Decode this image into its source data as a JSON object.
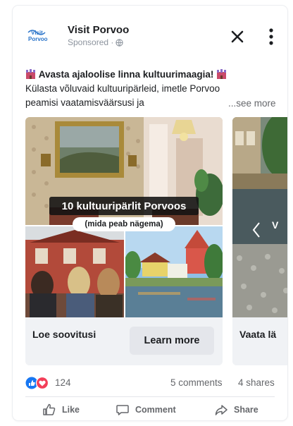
{
  "post": {
    "page_name": "Visit Porvoo",
    "sponsored": "Sponsored ·",
    "logo_line1": "Visit",
    "logo_line2": "Porvoo",
    "caption_line1": "Avasta ajaloolise linna kultuurimaagia!",
    "caption_line2": "Külasta võluvaid kultuuripärleid, imetle Porvoo",
    "caption_line3": "peamisi vaatamisväärsusi ja",
    "see_more": "...see more"
  },
  "carousel": {
    "cards": [
      {
        "overlay_title": "10 kultuuripärlit Porvoos",
        "overlay_sub": "(mida peab nägema)",
        "cta_title": "Loe soovitusi",
        "button": "Learn more"
      },
      {
        "cta_title": "Vaata lä"
      }
    ]
  },
  "stats": {
    "reactions": "124",
    "comments": "5 comments",
    "shares": "4 shares"
  },
  "actions": {
    "like": "Like",
    "comment": "Comment",
    "share": "Share"
  },
  "colors": {
    "like_blue": "#1877f2",
    "love_red": "#f33e58",
    "logo_blue": "#2a74c9"
  },
  "icons": [
    "globe-icon",
    "close-icon",
    "more-vertical-icon",
    "castle-icon",
    "like-reaction-icon",
    "love-reaction-icon",
    "thumbs-up-icon",
    "comment-icon",
    "share-icon"
  ]
}
